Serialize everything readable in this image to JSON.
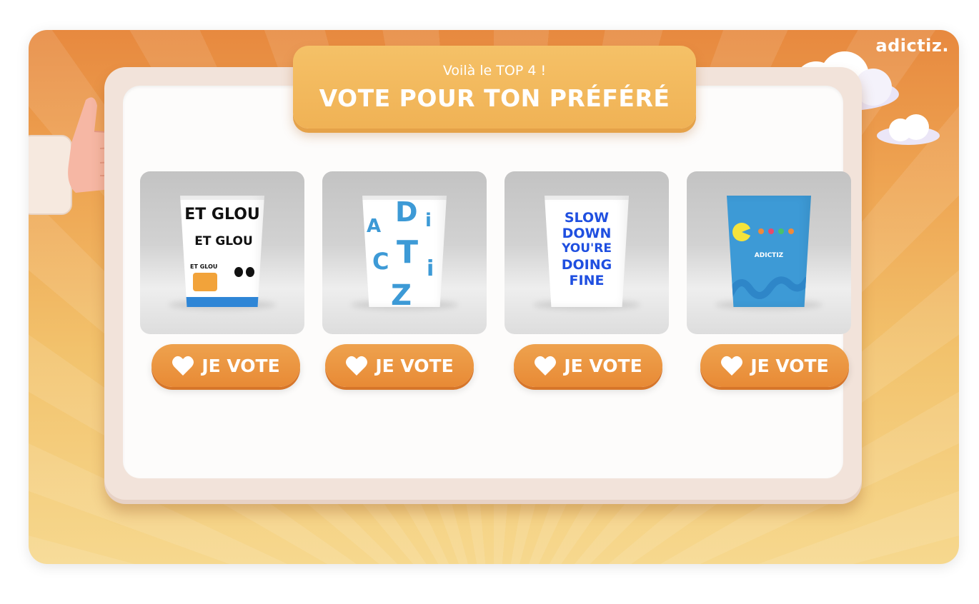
{
  "brand": {
    "logo_text": "adictiz."
  },
  "header": {
    "subtitle": "Voilà le TOP 4 !",
    "title": "VOTE POUR TON PRÉFÉRÉ"
  },
  "cards": [
    {
      "design_lines": [
        "ET GLOU",
        "ET GLOU",
        "ET GLOU"
      ],
      "vote_label": "JE VOTE"
    },
    {
      "design_lines": [
        "A",
        "D",
        "i",
        "C",
        "T",
        "i",
        "Z"
      ],
      "vote_label": "JE VOTE"
    },
    {
      "design_lines": [
        "SLOW",
        "DOWN",
        "YOU'RE",
        "DOING",
        "FINE"
      ],
      "vote_label": "JE VOTE"
    },
    {
      "design_lines": [
        "ADICTIZ"
      ],
      "vote_label": "JE VOTE"
    }
  ],
  "icons": {
    "vote_icon": "heart-icon",
    "decor": [
      "thumbs-up-hand",
      "cloud"
    ]
  },
  "colors": {
    "accent": "#e88a35",
    "header": "#f0b255",
    "background_top": "#e7893f",
    "background_bottom": "#f6d88e",
    "cup_blue": "#3d9ad6"
  }
}
